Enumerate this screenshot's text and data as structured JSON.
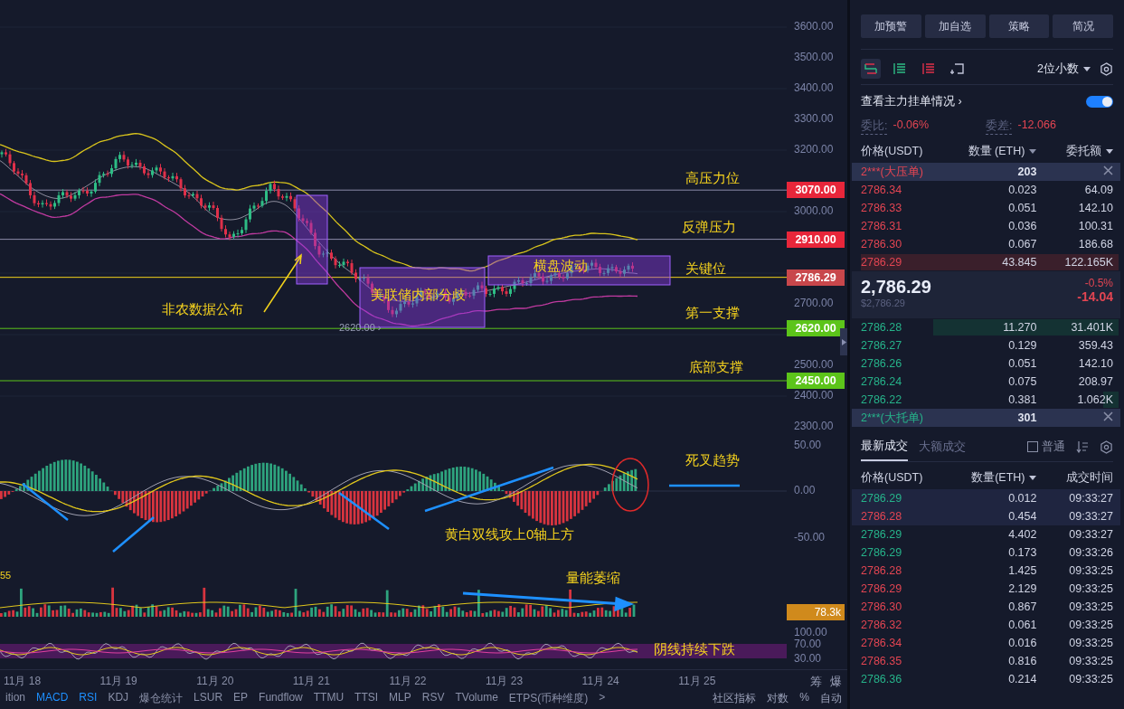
{
  "chart": {
    "price_axis": [
      "3600.00",
      "3500.00",
      "3400.00",
      "3300.00",
      "3200.00",
      "3000.00",
      "2700.00",
      "2500.00",
      "2400.00",
      "2300.00"
    ],
    "price_levels": [
      {
        "tag": "3070.00",
        "color": "#e8263a",
        "label": "高压力位"
      },
      {
        "tag": "2910.00",
        "color": "#e8263a",
        "label": "反弹压力"
      },
      {
        "tag": "2786.29",
        "color": "#c8474b",
        "label": "关键位"
      },
      {
        "tag": "2620.00",
        "color": "#5cc41a",
        "label": "第一支撑"
      },
      {
        "tag": "2450.00",
        "color": "#5cc41a",
        "label": "底部支撑"
      }
    ],
    "annotations": [
      "非农数据公布",
      "美联储内部分歧",
      "横盘波动"
    ],
    "low_marker": "2620.00 ›",
    "macd": {
      "axis": [
        "50.00",
        "0.00",
        "-50.00"
      ],
      "notes": [
        "死叉趋势",
        "黄白双线攻上0轴上方"
      ]
    },
    "volume": {
      "axis_label": "55",
      "note": "量能萎缩",
      "tag": "78.3k"
    },
    "rsi": {
      "axis": [
        "100.00",
        "70.00",
        "30.00"
      ],
      "note": "阴线持续下跌"
    },
    "dates": [
      "11月 18",
      "11月 19",
      "11月 20",
      "11月 21",
      "11月 22",
      "11月 23",
      "11月 24",
      "11月 25"
    ],
    "side_labels": [
      "筹",
      "爆"
    ],
    "indicator_tabs": [
      {
        "label": "ition",
        "selected": false
      },
      {
        "label": "MACD",
        "selected": true
      },
      {
        "label": "RSI",
        "selected": true
      },
      {
        "label": "KDJ",
        "selected": false
      },
      {
        "label": "爆仓统计",
        "selected": false
      },
      {
        "label": "LSUR",
        "selected": false
      },
      {
        "label": "EP",
        "selected": false
      },
      {
        "label": "Fundflow",
        "selected": false
      },
      {
        "label": "TTMU",
        "selected": false
      },
      {
        "label": "TTSI",
        "selected": false
      },
      {
        "label": "MLP",
        "selected": false
      },
      {
        "label": "RSV",
        "selected": false
      },
      {
        "label": "TVolume",
        "selected": false
      },
      {
        "label": "ETPS(币种维度)",
        "selected": false
      },
      {
        "label": ">",
        "selected": false
      }
    ],
    "indicator_tools": [
      "社区指标",
      "对数",
      "%",
      "自动"
    ]
  },
  "panel": {
    "buttons": [
      "加预警",
      "加自选",
      "策略",
      "简况"
    ],
    "view_modes": [
      {
        "selected": true
      },
      {
        "selected": false
      },
      {
        "selected": false
      },
      {
        "selected": false
      }
    ],
    "precision": "2位小数",
    "main_orders": {
      "label": "查看主力挂单情况 ›",
      "on": true
    },
    "ratio": {
      "label": "委比:",
      "value": "-0.06%"
    },
    "diff": {
      "label": "委差:",
      "value": "-12.066"
    },
    "book_columns": [
      "价格(USDT)",
      "数量 (ETH)",
      "委托额"
    ],
    "big_ask": {
      "label": "2***(大压单)",
      "value": "203"
    },
    "asks": [
      {
        "price": "2786.34",
        "amount": "0.023",
        "total": "64.09"
      },
      {
        "price": "2786.33",
        "amount": "0.051",
        "total": "142.10"
      },
      {
        "price": "2786.31",
        "amount": "0.036",
        "total": "100.31"
      },
      {
        "price": "2786.30",
        "amount": "0.067",
        "total": "186.68"
      },
      {
        "price": "2786.29",
        "amount": "43.845",
        "total": "122.165K",
        "level": 1
      }
    ],
    "last": {
      "price": "2,786.29",
      "usd": "$2,786.29",
      "pct": "-0.5%",
      "change": "-14.04"
    },
    "bids": [
      {
        "price": "2786.28",
        "amount": "11.270",
        "total": "31.401K",
        "level": 0.72
      },
      {
        "price": "2786.27",
        "amount": "0.129",
        "total": "359.43"
      },
      {
        "price": "2786.26",
        "amount": "0.051",
        "total": "142.10"
      },
      {
        "price": "2786.24",
        "amount": "0.075",
        "total": "208.97"
      },
      {
        "price": "2786.22",
        "amount": "0.381",
        "total": "1.062K",
        "level": 0.06
      }
    ],
    "big_bid": {
      "label": "2***(大托单)",
      "value": "301"
    },
    "trade_tabs": [
      {
        "label": "最新成交",
        "selected": true
      },
      {
        "label": "大额成交",
        "selected": false
      }
    ],
    "normal_filter": {
      "label": "普通",
      "checked": false
    },
    "trade_columns": [
      "价格(USDT)",
      "数量(ETH)",
      "成交时间"
    ],
    "trades": [
      {
        "price": "2786.29",
        "amount": "0.012",
        "time": "09:33:27",
        "color": "#26b38a"
      },
      {
        "price": "2786.28",
        "amount": "0.454",
        "time": "09:33:27",
        "color": "#e34552"
      },
      {
        "price": "2786.29",
        "amount": "4.402",
        "time": "09:33:27",
        "color": "#26b38a"
      },
      {
        "price": "2786.29",
        "amount": "0.173",
        "time": "09:33:26",
        "color": "#26b38a"
      },
      {
        "price": "2786.28",
        "amount": "1.425",
        "time": "09:33:25",
        "color": "#e34552"
      },
      {
        "price": "2786.29",
        "amount": "2.129",
        "time": "09:33:25",
        "color": "#e34552"
      },
      {
        "price": "2786.30",
        "amount": "0.867",
        "time": "09:33:25",
        "color": "#e34552"
      },
      {
        "price": "2786.32",
        "amount": "0.061",
        "time": "09:33:25",
        "color": "#e34552"
      },
      {
        "price": "2786.34",
        "amount": "0.016",
        "time": "09:33:25",
        "color": "#e34552"
      },
      {
        "price": "2786.35",
        "amount": "0.816",
        "time": "09:33:25",
        "color": "#e34552"
      },
      {
        "price": "2786.36",
        "amount": "0.214",
        "time": "09:33:25",
        "color": "#26b38a"
      }
    ]
  }
}
